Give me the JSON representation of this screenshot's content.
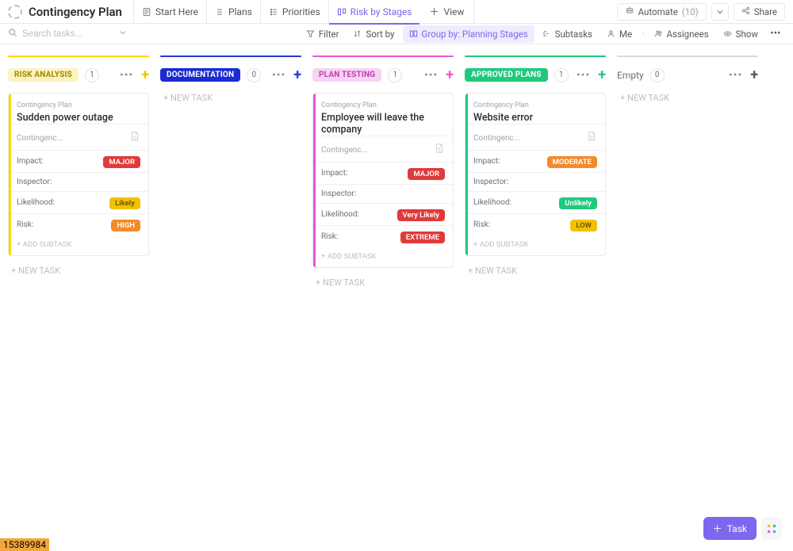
{
  "header": {
    "title": "Contingency Plan",
    "tabs": [
      {
        "label": "Start Here"
      },
      {
        "label": "Plans"
      },
      {
        "label": "Priorities"
      },
      {
        "label": "Risk by Stages"
      }
    ],
    "add_view": "View",
    "automate": {
      "label": "Automate",
      "count": "(10)"
    },
    "share": "Share"
  },
  "filters": {
    "search_placeholder": "Search tasks...",
    "filter": "Filter",
    "sort": "Sort by",
    "group": "Group by: Planning Stages",
    "subtasks": "Subtasks",
    "me": "Me",
    "assignees": "Assignees",
    "show": "Show"
  },
  "colors": {
    "risk_analysis": {
      "top": "#f9d900",
      "pill_bg": "#fcf3c1",
      "pill_text": "#9a8a00",
      "add": "#f2c200"
    },
    "documentation": {
      "top": "#1f3bdc",
      "pill_bg": "#1b2bd3",
      "pill_text": "#ffffff",
      "add": "#1f3bdc"
    },
    "plan_testing": {
      "top": "#e857d6",
      "pill_bg": "#f8d3f3",
      "pill_text": "#c23cb2",
      "add": "#e857d6"
    },
    "approved": {
      "top": "#1fc97c",
      "pill_bg": "#1fc97c",
      "pill_text": "#ffffff",
      "add": "#1fc97c"
    },
    "empty": {
      "top": "#d7d9de"
    },
    "impact_major": "#e03a3a",
    "impact_moderate": "#f28b2c",
    "like_likely": "#f2c200",
    "like_very": "#e03a3a",
    "like_unlikely": "#1fc97c",
    "risk_high": "#f28b2c",
    "risk_extreme": "#e03a3a",
    "risk_low": "#f2c200"
  },
  "board": {
    "new_task": "+ NEW TASK",
    "add_subtask": "+ ADD SUBTASK",
    "columns": [
      {
        "id": "risk_analysis",
        "label": "RISK ANALYSIS",
        "count": "1",
        "cards": [
          {
            "crumb": "Contingency Plan",
            "title": "Sudden power outage",
            "contingency": "Contingenc...",
            "impact": {
              "label": "MAJOR",
              "color": "impact_major"
            },
            "likelihood": {
              "label": "Likely",
              "color": "like_likely"
            },
            "risk": {
              "label": "HIGH",
              "color": "risk_high"
            }
          }
        ]
      },
      {
        "id": "documentation",
        "label": "DOCUMENTATION",
        "count": "0",
        "cards": []
      },
      {
        "id": "plan_testing",
        "label": "PLAN TESTING",
        "count": "1",
        "cards": [
          {
            "crumb": "Contingency Plan",
            "title": "Employee will leave the company",
            "contingency": "Contingenc...",
            "impact": {
              "label": "MAJOR",
              "color": "impact_major"
            },
            "likelihood": {
              "label": "Very Likely",
              "color": "like_very"
            },
            "risk": {
              "label": "EXTREME",
              "color": "risk_extreme"
            }
          }
        ]
      },
      {
        "id": "approved",
        "label": "APPROVED PLANS",
        "count": "1",
        "cards": [
          {
            "crumb": "Contingency Plan",
            "title": "Website error",
            "contingency": "Contingenc...",
            "impact": {
              "label": "MODERATE",
              "color": "impact_moderate"
            },
            "likelihood": {
              "label": "Unlikely",
              "color": "like_unlikely"
            },
            "risk": {
              "label": "LOW",
              "color": "risk_low"
            }
          }
        ]
      },
      {
        "id": "empty",
        "label": "Empty",
        "count": "0",
        "cards": [],
        "is_empty_group": true
      }
    ],
    "field_labels": {
      "impact": "Impact:",
      "inspector": "Inspector:",
      "likelihood": "Likelihood:",
      "risk": "Risk:"
    }
  },
  "footer": {
    "task": "Task",
    "bottom_badge": "15389984"
  }
}
